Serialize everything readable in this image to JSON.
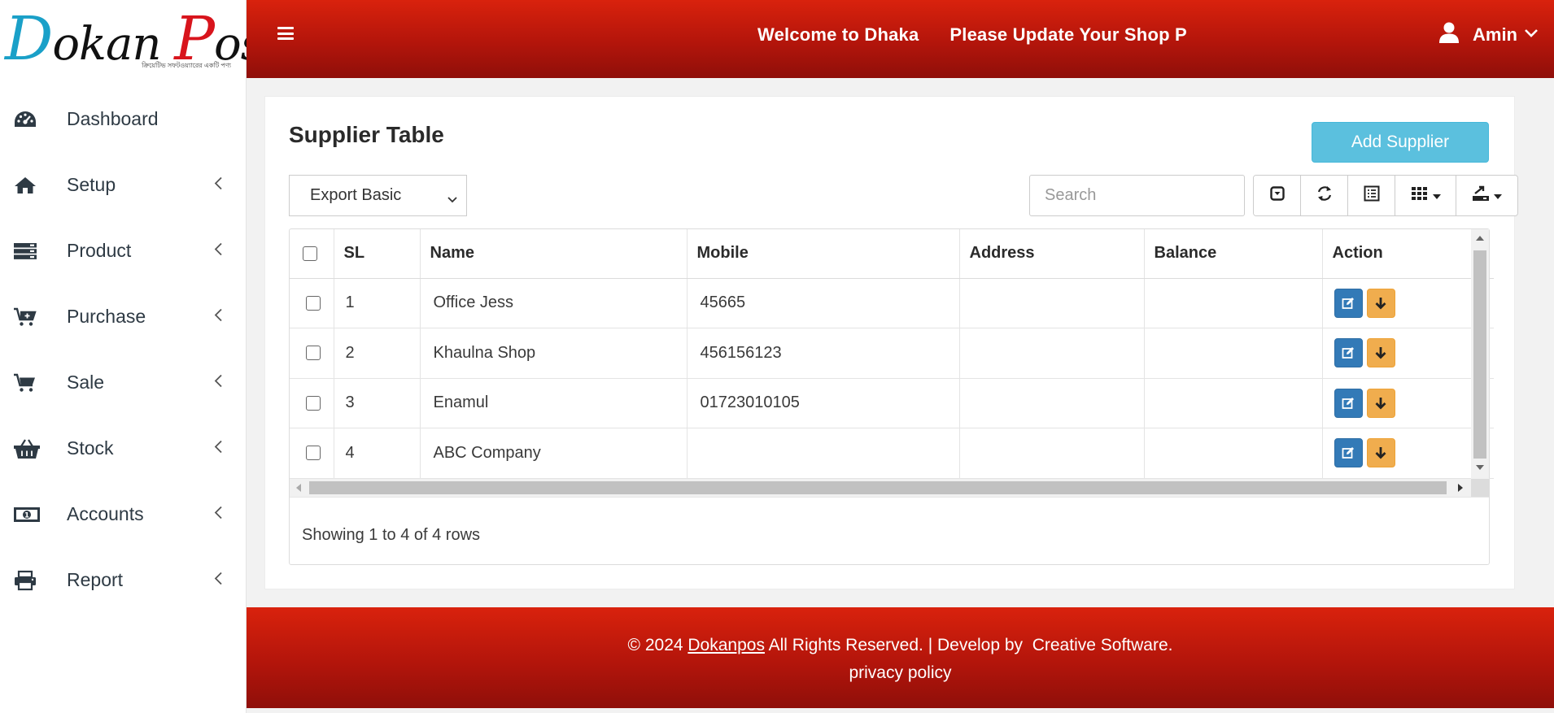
{
  "app": {
    "logo_text_1": "D",
    "logo_text_2": "okan ",
    "logo_text_3": "P",
    "logo_text_4": "os",
    "logo_tagline": "ক্রিয়েটিভ সফটওয়্যারের একটি পণ্য"
  },
  "sidebar": {
    "items": [
      {
        "label": "Dashboard",
        "icon": "dashboard-icon",
        "has_submenu": false
      },
      {
        "label": "Setup",
        "icon": "home-icon",
        "has_submenu": true
      },
      {
        "label": "Product",
        "icon": "server-icon",
        "has_submenu": true
      },
      {
        "label": "Purchase",
        "icon": "cart-plus-icon",
        "has_submenu": true
      },
      {
        "label": "Sale",
        "icon": "cart-icon",
        "has_submenu": true
      },
      {
        "label": "Stock",
        "icon": "basket-icon",
        "has_submenu": true
      },
      {
        "label": "Accounts",
        "icon": "money-icon",
        "has_submenu": true
      },
      {
        "label": "Report",
        "icon": "print-icon",
        "has_submenu": true
      }
    ]
  },
  "header": {
    "marquee_1": "Welcome to Dhaka",
    "marquee_2": "Please Update Your Shop P",
    "user_name": "Amin"
  },
  "page": {
    "title": "Supplier Table",
    "add_button": "Add Supplier",
    "export_select": "Export Basic",
    "search_placeholder": "Search"
  },
  "table": {
    "columns": [
      "SL",
      "Name",
      "Mobile",
      "Address",
      "Balance",
      "Action"
    ],
    "rows": [
      {
        "sl": "1",
        "name": "Office Jess",
        "mobile": "45665",
        "address": "",
        "balance": ""
      },
      {
        "sl": "2",
        "name": "Khaulna Shop",
        "mobile": "456156123",
        "address": "",
        "balance": ""
      },
      {
        "sl": "3",
        "name": "Enamul",
        "mobile": "01723010105",
        "address": "",
        "balance": ""
      },
      {
        "sl": "4",
        "name": "ABC Company",
        "mobile": "",
        "address": "",
        "balance": ""
      }
    ],
    "showing": "Showing 1 to 4 of 4 rows"
  },
  "footer": {
    "copyright_prefix": "© 2024 ",
    "brand_link": "Dokanpos",
    "copyright_suffix": " All Rights Reserved. | Develop by  Creative Software.",
    "privacy": "privacy policy"
  },
  "colors": {
    "header_red": "#c41a0c",
    "button_info": "#5bc0de",
    "button_edit": "#337ab7",
    "button_warning": "#f0ad4e",
    "logo_blue": "#1aa0c8",
    "logo_red": "#d8141c"
  }
}
